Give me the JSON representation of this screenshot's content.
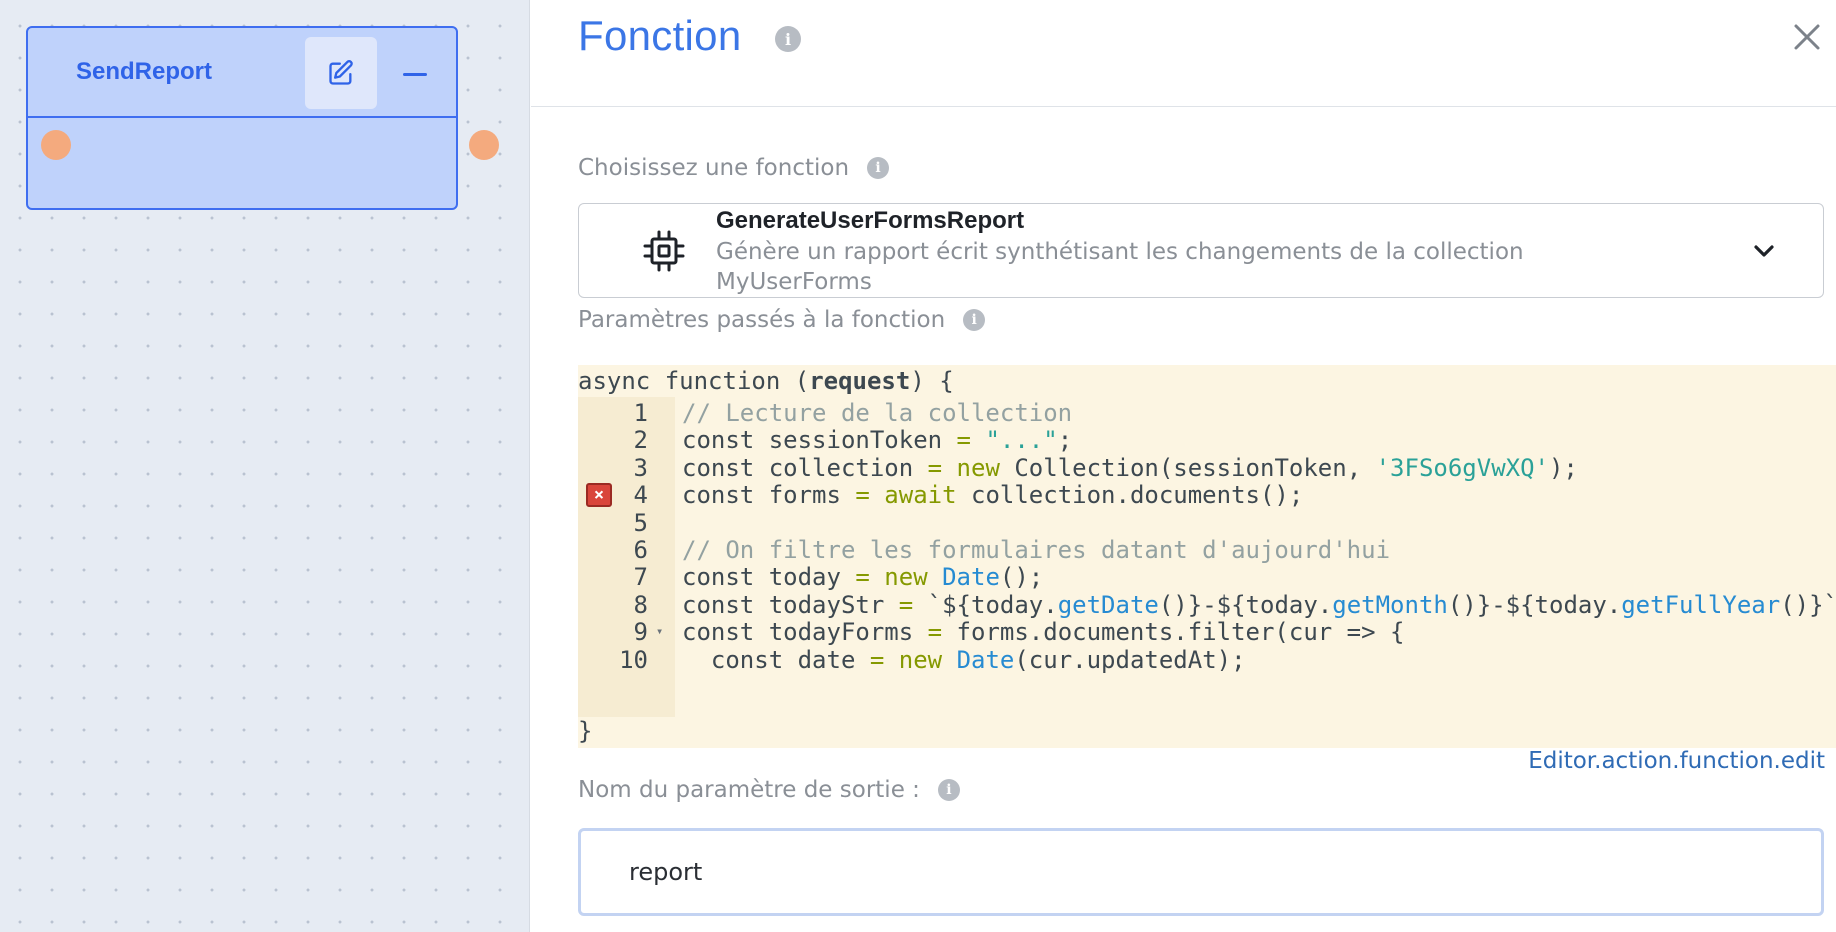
{
  "node": {
    "title": "SendReport",
    "edit_icon": "edit-icon",
    "collapse_icon": "minus-icon"
  },
  "panel": {
    "title": "Fonction",
    "close_icon": "close-icon",
    "choose_label": "Choisissez une fonction",
    "selected_function": {
      "name": "GenerateUserFormsReport",
      "description": "Génère un rapport écrit synthétisant les changements de la collection MyUserForms",
      "icon": "chip-icon"
    },
    "params_label": "Paramètres passés à la fonction",
    "code": {
      "header": "async function (request) {",
      "footer": "}",
      "lines": [
        {
          "n": "1",
          "text": "// Lecture de la collection"
        },
        {
          "n": "2",
          "text": "const sessionToken = \"...\";"
        },
        {
          "n": "3",
          "text": "const collection = new Collection(sessionToken, '3FSo6gVwXQ');"
        },
        {
          "n": "4",
          "text": "const forms = await collection.documents();",
          "error": true
        },
        {
          "n": "5",
          "text": ""
        },
        {
          "n": "6",
          "text": "// On filtre les formulaires datant d'aujourd'hui"
        },
        {
          "n": "7",
          "text": "const today = new Date();"
        },
        {
          "n": "8",
          "text": "const todayStr = `${today.getDate()}-${today.getMonth()}-${today.getFullYear()}`"
        },
        {
          "n": "9",
          "text": "const todayForms = forms.documents.filter(cur => {",
          "fold": true
        },
        {
          "n": "10",
          "text": "  const date = new Date(cur.updatedAt);"
        }
      ]
    },
    "edit_link": "Editor.action.function.edit",
    "output_label": "Nom du paramètre de sortie :",
    "output_value": "report",
    "colors": {
      "accent": "#3b76e6",
      "node_bg": "#bfd2fb",
      "port": "#f4aa7e",
      "code_bg": "#fcf5e2"
    }
  }
}
